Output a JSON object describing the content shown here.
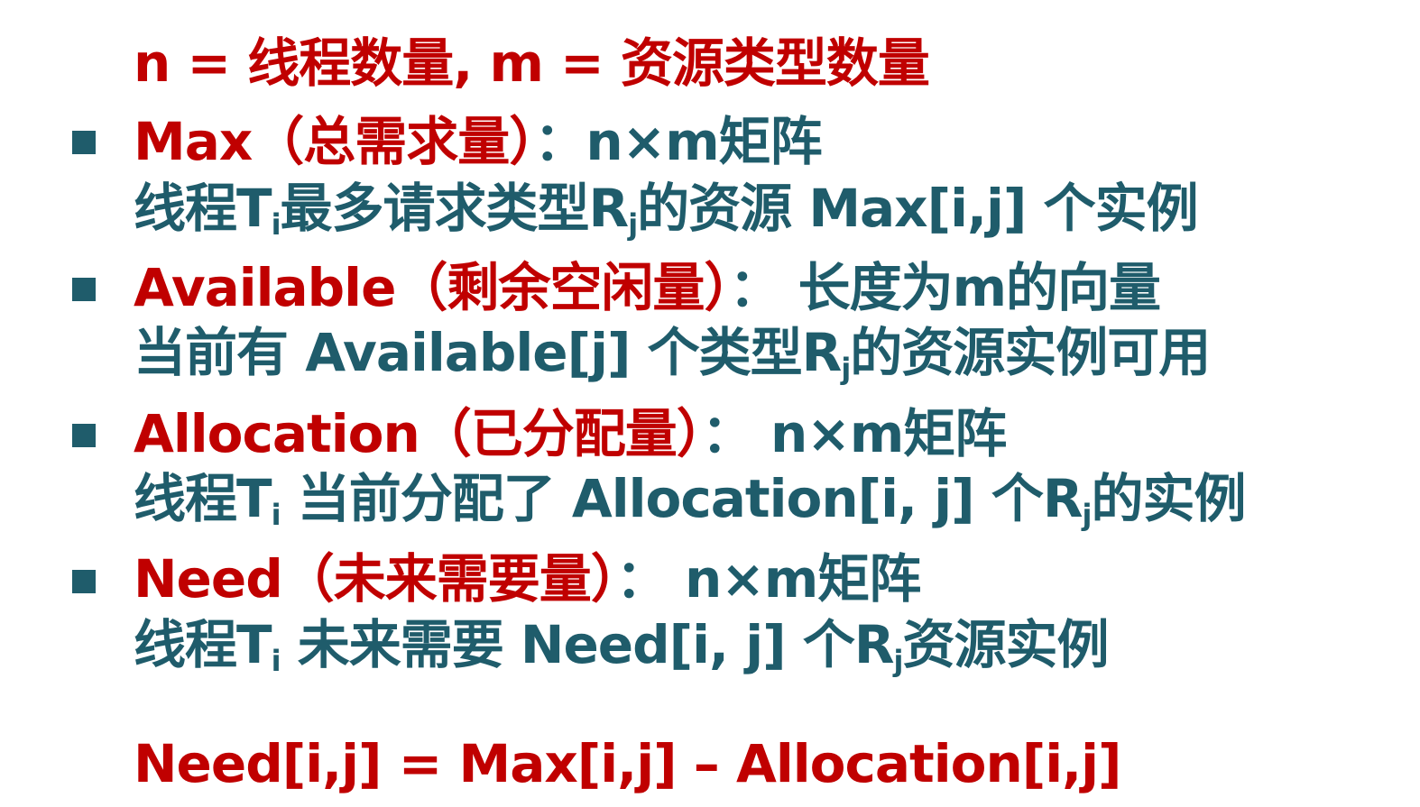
{
  "defs": {
    "counts": "n = 线程数量, m = 资源类型数量"
  },
  "items": [
    {
      "name": "Max",
      "paren": "（总需求量）",
      "colon": "：",
      "type": "n×m矩阵",
      "desc": {
        "a": "线程T",
        "sub1": "i",
        "b": "最多请求类型R",
        "sub2": "j",
        "c": "的资源 Max[i,j] 个实例"
      }
    },
    {
      "name": "Available",
      "paren": "（剩余空闲量）",
      "colon": "： ",
      "type": "长度为m的向量",
      "desc": {
        "a": "当前有 Available[j] 个类型R",
        "sub1": "j",
        "b": "的资源实例可用"
      }
    },
    {
      "name": "Allocation",
      "paren": "（已分配量）",
      "colon": "： ",
      "type": "n×m矩阵",
      "desc": {
        "a": "线程T",
        "sub1": "i",
        "b": " 当前分配了 Allocation[i, j] 个R",
        "sub2": "j",
        "c": "的实例"
      }
    },
    {
      "name": "Need",
      "paren": "（未来需要量）",
      "colon": "： ",
      "type": "n×m矩阵",
      "desc": {
        "a": "线程T",
        "sub1": "i",
        "b": " 未来需要 Need[i, j] 个R",
        "sub2": "j",
        "c": "资源实例"
      }
    }
  ],
  "formula": "Need[i,j] = Max[i,j] – Allocation[i,j]",
  "colors": {
    "red": "#c00000",
    "teal": "#1f5c6b"
  }
}
